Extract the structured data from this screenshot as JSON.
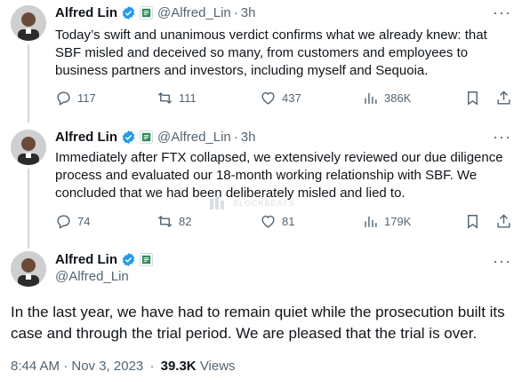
{
  "tweets": [
    {
      "author": {
        "name": "Alfred Lin",
        "handle": "@Alfred_Lin",
        "time": "3h"
      },
      "text": "Today’s swift and unanimous verdict confirms what we already knew: that SBF misled and deceived so many, from customers and employees to business partners and investors, including myself and Sequoia.",
      "stats": {
        "replies": "117",
        "reposts": "111",
        "likes": "437",
        "views": "386K"
      }
    },
    {
      "author": {
        "name": "Alfred Lin",
        "handle": "@Alfred_Lin",
        "time": "3h"
      },
      "text": "Immediately after FTX collapsed, we extensively reviewed our due diligence process and evaluated our 18-month working relationship with SBF.  We concluded that we had been deliberately misled and lied to.",
      "stats": {
        "replies": "74",
        "reposts": "82",
        "likes": "81",
        "views": "179K"
      }
    }
  ],
  "main_tweet": {
    "author": {
      "name": "Alfred Lin",
      "handle": "@Alfred_Lin"
    },
    "text": "In the last year, we have had to remain quiet while the prosecution built its case and through the trial period. We are pleased that the trial is over.",
    "timestamp": "8:44 AM · Nov 3, 2023",
    "views_count": "39.3K",
    "views_label": "Views"
  },
  "more_glyph": "···",
  "separator": "·",
  "watermark": "BLOCKBEATS",
  "colors": {
    "verified": "#1d9bf0",
    "affiliate": "#2e8b57",
    "muted": "#536471"
  }
}
